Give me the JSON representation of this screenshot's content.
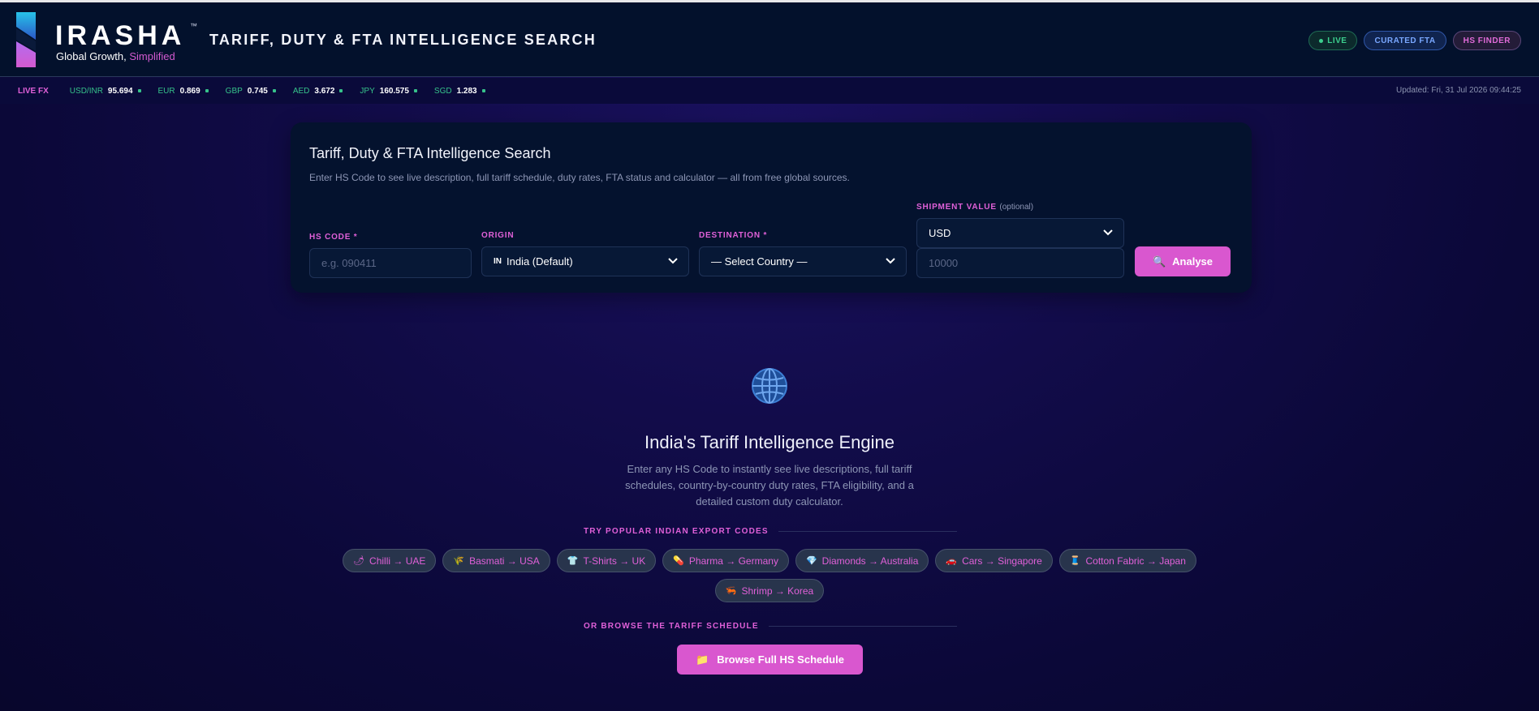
{
  "header": {
    "brand": "IRASHA",
    "trademark": "™",
    "tagline_main": "Global Growth,",
    "tagline_accent": "Simplified",
    "page_heading": "TARIFF, DUTY & FTA INTELLIGENCE SEARCH",
    "badges": {
      "live": "LIVE",
      "curated_fta": "CURATED FTA",
      "hs_finder": "HS FINDER"
    }
  },
  "fx": {
    "label": "LIVE FX",
    "rates": [
      {
        "code": "USD/INR",
        "value": "95.694"
      },
      {
        "code": "EUR",
        "value": "0.869"
      },
      {
        "code": "GBP",
        "value": "0.745"
      },
      {
        "code": "AED",
        "value": "3.672"
      },
      {
        "code": "JPY",
        "value": "160.575"
      },
      {
        "code": "SGD",
        "value": "1.283"
      }
    ],
    "updated": "Updated: Fri, 31 Jul 2026 09:44:25"
  },
  "search": {
    "title": "Tariff, Duty & FTA Intelligence Search",
    "subtitle": "Enter HS Code to see live description, full tariff schedule, duty rates, FTA status and calculator — all from free global sources.",
    "hs_code": {
      "label": "HS CODE",
      "required": "*",
      "placeholder": "e.g. 090411",
      "value": ""
    },
    "origin": {
      "label": "ORIGIN",
      "flag": "IN",
      "value": "India (Default)"
    },
    "destination": {
      "label": "DESTINATION",
      "required": "*",
      "value": "— Select Country —"
    },
    "shipment": {
      "label": "SHIPMENT VALUE",
      "optional": "(optional)",
      "currency": "USD",
      "placeholder": "10000"
    },
    "analyse_label": "Analyse"
  },
  "hero": {
    "title": "India's Tariff Intelligence Engine",
    "description": "Enter any HS Code to instantly see live descriptions, full tariff schedules, country-by-country duty rates, FTA eligibility, and a detailed custom duty calculator."
  },
  "popular": {
    "heading": "TRY POPULAR INDIAN EXPORT CODES",
    "chips": [
      {
        "icon": "🌶",
        "label": "Chilli → UAE"
      },
      {
        "icon": "🌾",
        "label": "Basmati → USA"
      },
      {
        "icon": "👕",
        "label": "T-Shirts → UK"
      },
      {
        "icon": "💊",
        "label": "Pharma → Germany"
      },
      {
        "icon": "💎",
        "label": "Diamonds → Australia"
      },
      {
        "icon": "🚗",
        "label": "Cars → Singapore"
      },
      {
        "icon": "🧵",
        "label": "Cotton Fabric → Japan"
      },
      {
        "icon": "🦐",
        "label": "Shrimp → Korea"
      }
    ]
  },
  "browse": {
    "heading": "OR BROWSE THE TARIFF SCHEDULE",
    "button_label": "Browse Full HS Schedule",
    "button_icon": "📁"
  },
  "colors": {
    "accent": "#d957cf",
    "live": "#36c28a",
    "header_bg": "#03112c",
    "card_bg": "#04122e"
  }
}
